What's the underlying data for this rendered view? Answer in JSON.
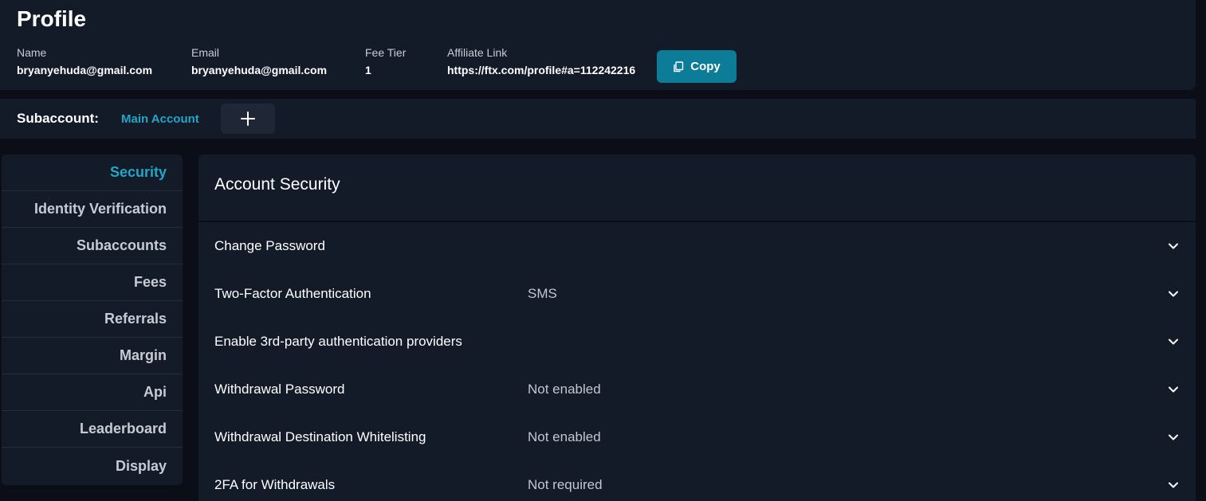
{
  "profile": {
    "title": "Profile",
    "fields": {
      "name": {
        "label": "Name",
        "value": "bryanyehuda@gmail.com"
      },
      "email": {
        "label": "Email",
        "value": "bryanyehuda@gmail.com"
      },
      "fee_tier": {
        "label": "Fee Tier",
        "value": "1"
      },
      "affiliate_link": {
        "label": "Affiliate Link",
        "value": "https://ftx.com/profile#a=112242216"
      }
    },
    "copy_button_label": "Copy",
    "copy_icon": "copy-icon"
  },
  "subaccount": {
    "label": "Subaccount:",
    "current": "Main Account",
    "add_icon": "plus-icon"
  },
  "sidebar": {
    "items": [
      {
        "label": "Security",
        "active": true
      },
      {
        "label": "Identity Verification",
        "active": false
      },
      {
        "label": "Subaccounts",
        "active": false
      },
      {
        "label": "Fees",
        "active": false
      },
      {
        "label": "Referrals",
        "active": false
      },
      {
        "label": "Margin",
        "active": false
      },
      {
        "label": "Api",
        "active": false
      },
      {
        "label": "Leaderboard",
        "active": false
      },
      {
        "label": "Display",
        "active": false
      }
    ]
  },
  "main": {
    "title": "Account Security",
    "settings": [
      {
        "label": "Change Password",
        "value": ""
      },
      {
        "label": "Two-Factor Authentication",
        "value": "SMS"
      },
      {
        "label": "Enable 3rd-party authentication providers",
        "value": ""
      },
      {
        "label": "Withdrawal Password",
        "value": "Not enabled"
      },
      {
        "label": "Withdrawal Destination Whitelisting",
        "value": "Not enabled"
      },
      {
        "label": "2FA for Withdrawals",
        "value": "Not required"
      }
    ],
    "expand_icon": "chevron-down-icon"
  },
  "colors": {
    "background": "#0b0e16",
    "panel": "#131a28",
    "accent": "#22a6c8",
    "copy_button": "#0d7c98"
  }
}
